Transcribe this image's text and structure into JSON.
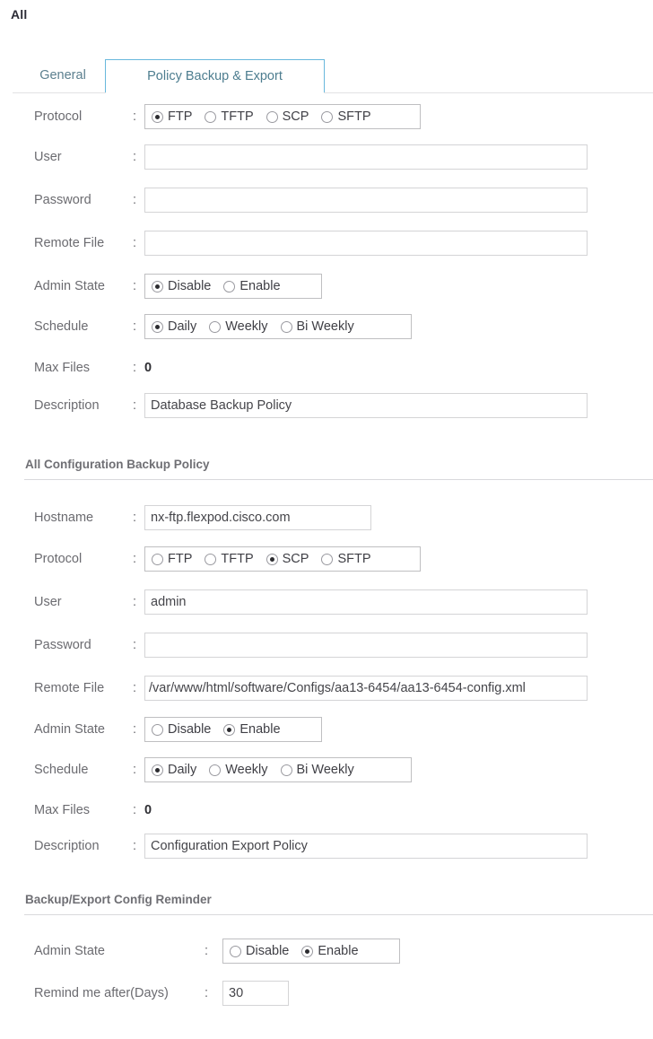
{
  "page": {
    "title": "All"
  },
  "tabs": [
    {
      "label": "General",
      "active": false
    },
    {
      "label": "Policy Backup & Export",
      "active": true
    }
  ],
  "colon": ":",
  "protocol_options": [
    "FTP",
    "TFTP",
    "SCP",
    "SFTP"
  ],
  "admin_state_options": [
    "Disable",
    "Enable"
  ],
  "schedule_options": [
    "Daily",
    "Weekly",
    "Bi Weekly"
  ],
  "db_backup_policy": {
    "protocol": {
      "label": "Protocol",
      "options": [
        "FTP",
        "TFTP",
        "SCP",
        "SFTP"
      ],
      "selected": "FTP"
    },
    "user": {
      "label": "User",
      "value": ""
    },
    "password": {
      "label": "Password",
      "value": ""
    },
    "remote_file": {
      "label": "Remote File",
      "value": ""
    },
    "admin_state": {
      "label": "Admin State",
      "options": [
        "Disable",
        "Enable"
      ],
      "selected": "Disable"
    },
    "schedule": {
      "label": "Schedule",
      "options": [
        "Daily",
        "Weekly",
        "Bi Weekly"
      ],
      "selected": "Daily"
    },
    "max_files": {
      "label": "Max Files",
      "value": "0"
    },
    "description": {
      "label": "Description",
      "value": "Database Backup Policy"
    }
  },
  "config_backup_policy": {
    "section_title": "All Configuration Backup Policy",
    "hostname": {
      "label": "Hostname",
      "value": "nx-ftp.flexpod.cisco.com"
    },
    "protocol": {
      "label": "Protocol",
      "options": [
        "FTP",
        "TFTP",
        "SCP",
        "SFTP"
      ],
      "selected": "SCP"
    },
    "user": {
      "label": "User",
      "value": "admin"
    },
    "password": {
      "label": "Password",
      "value": ""
    },
    "remote_file": {
      "label": "Remote File",
      "value": "/var/www/html/software/Configs/aa13-6454/aa13-6454-config.xml"
    },
    "admin_state": {
      "label": "Admin State",
      "options": [
        "Disable",
        "Enable"
      ],
      "selected": "Enable"
    },
    "schedule": {
      "label": "Schedule",
      "options": [
        "Daily",
        "Weekly",
        "Bi Weekly"
      ],
      "selected": "Daily"
    },
    "max_files": {
      "label": "Max Files",
      "value": "0"
    },
    "description": {
      "label": "Description",
      "value": "Configuration Export Policy"
    }
  },
  "reminder": {
    "section_title": "Backup/Export Config Reminder",
    "admin_state": {
      "label": "Admin State",
      "options": [
        "Disable",
        "Enable"
      ],
      "selected": "Enable"
    },
    "remind_after": {
      "label": "Remind me after(Days)",
      "value": "30"
    }
  },
  "colors": {
    "active_tab_border": "#68b8dc",
    "tab_text": "#4d7d8f",
    "label_text": "#6b6b70",
    "section_title": "#6f6f74",
    "input_border": "#d4d4d6",
    "radio_dot": "#2c2c30"
  }
}
